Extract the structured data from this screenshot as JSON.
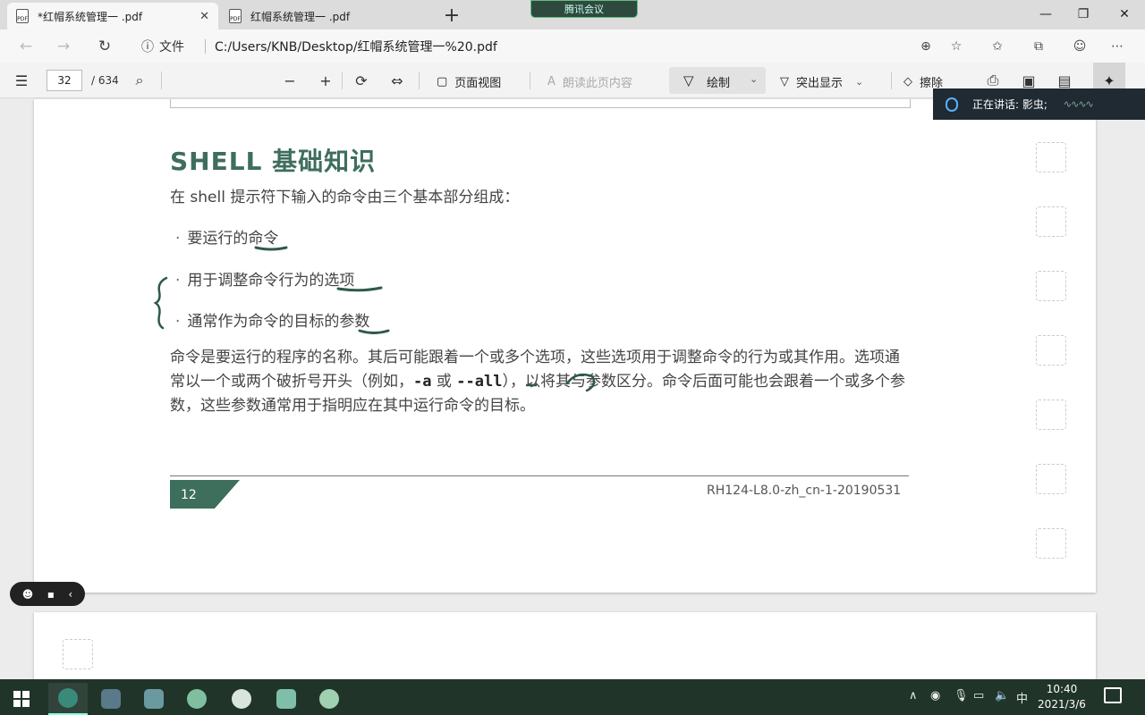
{
  "browser": {
    "tabs": [
      {
        "label": "*红帽系统管理一 .pdf",
        "active": true
      },
      {
        "label": "红帽系统管理一 .pdf",
        "active": false
      }
    ],
    "meeting_badge": "腾讯会议",
    "address": {
      "file_label": "文件",
      "url": "C:/Users/KNB/Desktop/红帽系统管理一%20.pdf"
    }
  },
  "pdf_toolbar": {
    "current_page": "32",
    "total_pages": "/ 634",
    "page_view": "页面视图",
    "read_aloud": "朗读此页内容",
    "draw": "绘制",
    "highlight": "突出显示",
    "erase": "擦除"
  },
  "speaking": {
    "label": "正在讲话: 影虫;"
  },
  "document": {
    "title": "SHELL 基础知识",
    "intro": "在 shell 提示符下输入的命令由三个基本部分组成：",
    "bullets": [
      {
        "text_plain": "要运行的",
        "text_key": "命令"
      },
      {
        "text_plain": "用于调整命令行为的",
        "text_key": "选项"
      },
      {
        "text_plain": "通常作为命令的目标的",
        "text_key": "参数"
      }
    ],
    "para": {
      "part1": "命令是要运行的程序的名称。其后可能跟着一个或多个选项，这些选项用于调整命令的行为或其作用。选项通常以一个或两个破折号开头（例如，",
      "opt1": "-a",
      "or": " 或 ",
      "opt2": "--all",
      "part2": "），以将其与参数区分。命令后面可能也会跟着一个或多个参数，这些参数通常用于指明应在其中运行命令的目标。"
    },
    "page_number": "12",
    "footer_code": "RH124-L8.0-zh_cn-1-20190531"
  },
  "taskbar": {
    "time": "10:40",
    "date": "2021/3/6",
    "ime": "中"
  },
  "colors": {
    "heading": "#3e6e5c",
    "taskbar": "#20342a",
    "ink": "#2f5a48"
  }
}
